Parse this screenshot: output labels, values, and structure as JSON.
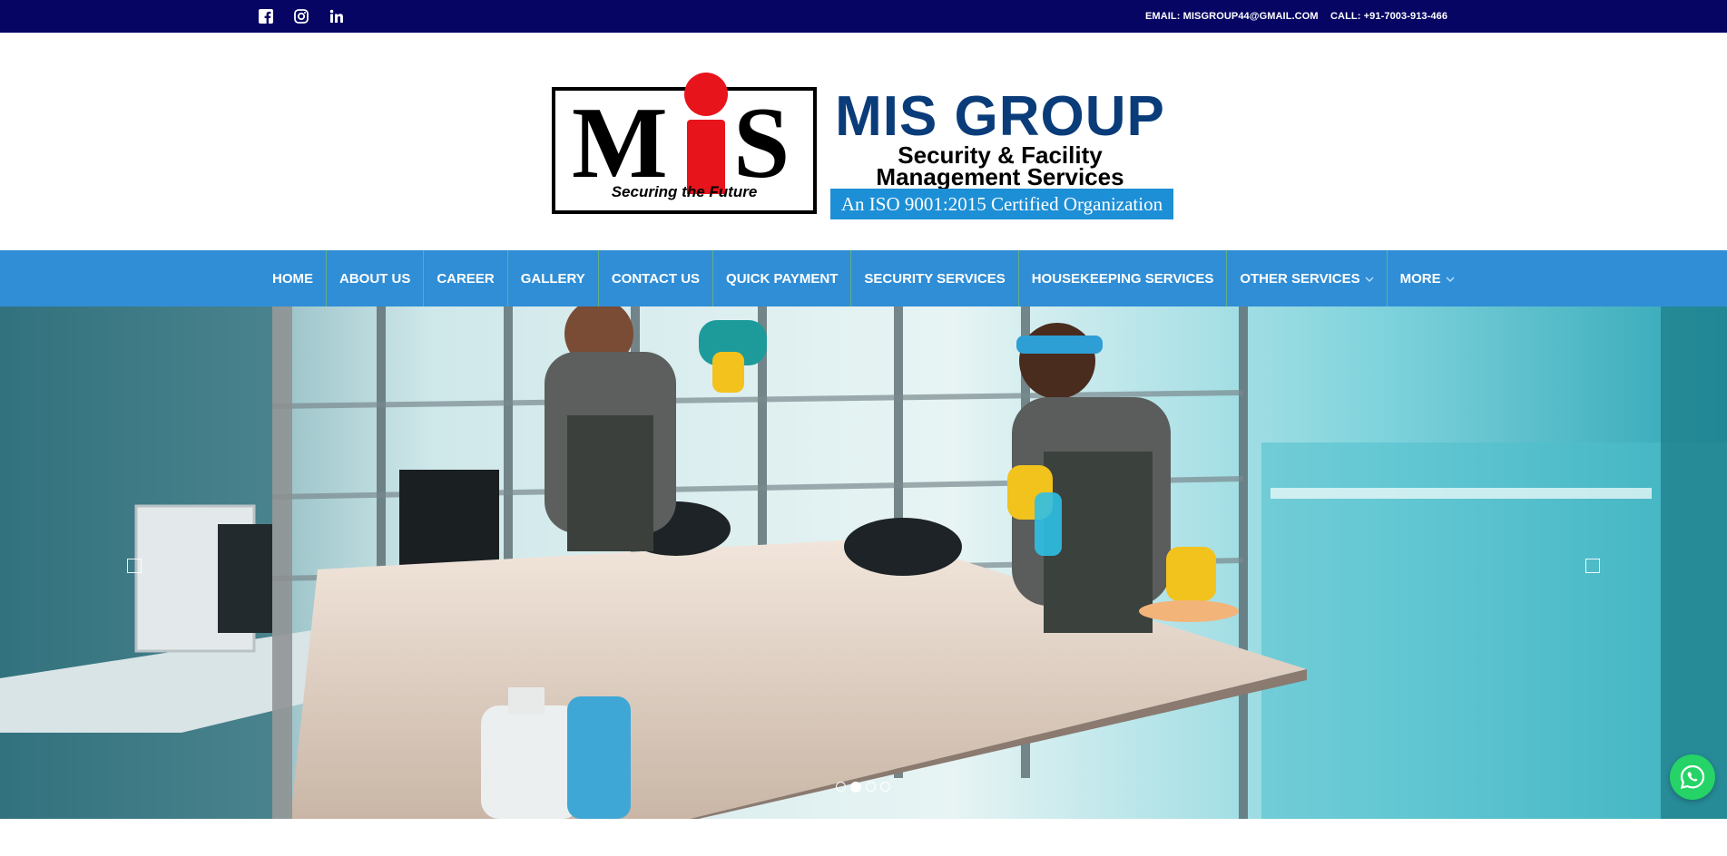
{
  "topbar": {
    "social": [
      "facebook-icon",
      "instagram-icon",
      "linkedin-icon"
    ],
    "email": "EMAIL: MISGROUP44@GMAIL.COM",
    "call": "CALL: +91-7003-913-466",
    "background": "#060563"
  },
  "logo": {
    "letter_m": "M",
    "letter_s": "S",
    "tagline": "Securing the Future",
    "title": "MIS GROUP",
    "subtitle_line1": "Security & Facility",
    "subtitle_line2": "Management Services",
    "iso_badge": "An ISO 9001:2015 Certified Organization",
    "colors": {
      "title": "#0a3c7a",
      "accent_red": "#e8141b",
      "iso_bg": "#1d8fd6"
    }
  },
  "nav": {
    "background": "#308ed6",
    "items": [
      {
        "label": "HOME",
        "dropdown": false
      },
      {
        "label": "ABOUT US",
        "dropdown": false
      },
      {
        "label": "CAREER",
        "dropdown": false
      },
      {
        "label": "GALLERY",
        "dropdown": false
      },
      {
        "label": "CONTACT US",
        "dropdown": false
      },
      {
        "label": "QUICK PAYMENT",
        "dropdown": false
      },
      {
        "label": "SECURITY SERVICES",
        "dropdown": false
      },
      {
        "label": "HOUSEKEEPING SERVICES",
        "dropdown": false
      },
      {
        "label": "OTHER SERVICES",
        "dropdown": true
      },
      {
        "label": "MORE",
        "dropdown": true
      }
    ]
  },
  "slider": {
    "slide_count": 4,
    "active_slide": 2,
    "image_subject": "cleaning-staff-in-office"
  },
  "floating": {
    "whatsapp": "whatsapp-icon"
  }
}
